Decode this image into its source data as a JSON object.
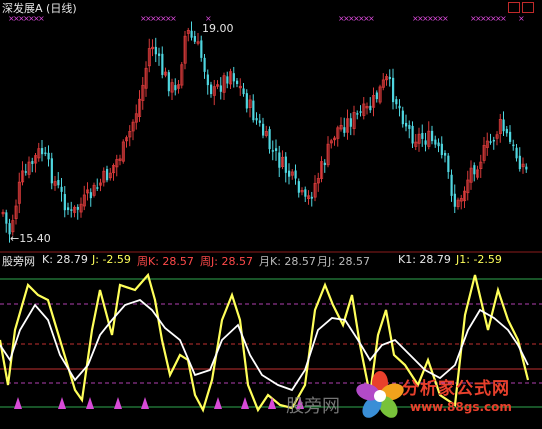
{
  "header": {
    "title": "深发展A (日线)",
    "high_label": "19.00",
    "low_label": "←15.40"
  },
  "indicator_row": {
    "name": "股旁网",
    "k": "K: 28.79",
    "j": "J: -2.59",
    "week_k": "周K: 28.57",
    "week_j": "周J: 28.57",
    "month_k": "月K: 28.57",
    "month_j": "月J: 28.57",
    "k1": "K1: 28.79",
    "j1": "J1: -2.59"
  },
  "watermark": "股旁网",
  "logo": {
    "name": "分析家公式网",
    "url": "www.88gs.com"
  },
  "colors": {
    "up": "#d83a3a",
    "down": "#4fd6e0",
    "marker": "#d84ad8",
    "k_line": "#ffffff",
    "j_line": "#ffff5a",
    "guide_green": "#2fa84f",
    "guide_purple": "#b040b0",
    "guide_red": "#c03030"
  },
  "controls": [
    "window-restore-icon",
    "window-close-icon"
  ]
}
